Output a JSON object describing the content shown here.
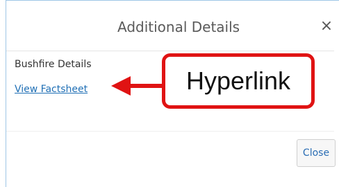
{
  "dialog": {
    "title": "Additional Details",
    "close_icon": "×",
    "section_label": "Bushfire Details",
    "link_label": "View Factsheet",
    "close_button_label": "Close"
  },
  "annotation": {
    "label": "Hyperlink",
    "color": "#e01313"
  },
  "colors": {
    "link": "#1f6fb5",
    "dialog_border": "#9ec6e6"
  }
}
